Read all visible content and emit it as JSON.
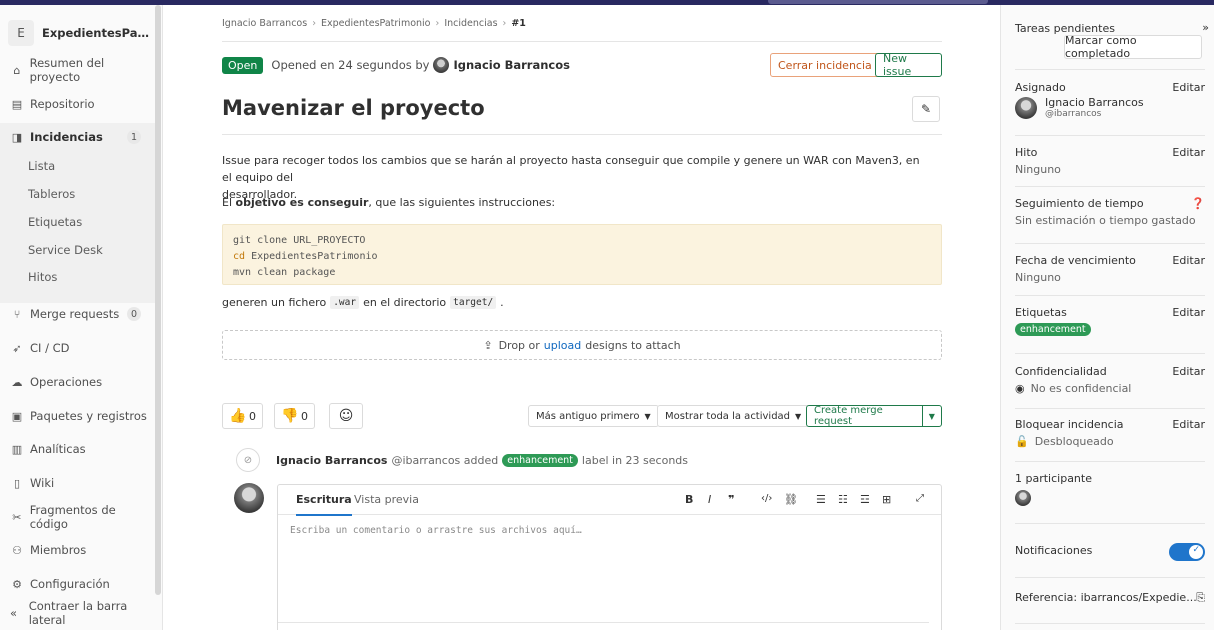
{
  "sidebar": {
    "project_initial": "E",
    "project_name": "ExpedientesPatrim...",
    "items": [
      {
        "label": "Resumen del proyecto",
        "icon": "home-icon"
      },
      {
        "label": "Repositorio",
        "icon": "file-icon"
      },
      {
        "label": "Incidencias",
        "icon": "issues-icon",
        "count": "1"
      },
      {
        "label": "Merge requests",
        "icon": "merge-request-icon",
        "count": "0"
      },
      {
        "label": "CI / CD",
        "icon": "rocket-icon"
      },
      {
        "label": "Operaciones",
        "icon": "cloud-icon"
      },
      {
        "label": "Paquetes y registros",
        "icon": "package-icon"
      },
      {
        "label": "Analíticas",
        "icon": "chart-icon"
      },
      {
        "label": "Wiki",
        "icon": "book-icon"
      },
      {
        "label": "Fragmentos de código",
        "icon": "snippet-icon"
      },
      {
        "label": "Miembros",
        "icon": "users-icon"
      },
      {
        "label": "Configuración",
        "icon": "gear-icon"
      }
    ],
    "sub_items": [
      "Lista",
      "Tableros",
      "Etiquetas",
      "Service Desk",
      "Hitos"
    ],
    "collapse_label": "Contraer la barra lateral"
  },
  "breadcrumb": [
    "Ignacio Barrancos",
    "ExpedientesPatrimonio",
    "Incidencias",
    "#1"
  ],
  "issue": {
    "status": "Open",
    "opened_prefix": "Opened en 24 segundos by",
    "author": "Ignacio Barrancos",
    "close_label": "Cerrar incidencia",
    "new_label": "New issue",
    "title": "Mavenizar el proyecto",
    "desc_line1": "Issue para recoger todos los cambios que se harán al proyecto hasta conseguir que compile y genere un WAR con Maven3, en el equipo del",
    "desc_line2": "desarrollador.",
    "desc2_prefix": "El",
    "desc2_bold": "objetivo es conseguir",
    "desc2_suffix": ", que las siguientes instrucciones:",
    "code": [
      "git clone URL_PROYECTO",
      "cd",
      "ExpedientesPatrimonio",
      "mvn clean package"
    ],
    "desc3_a": "generen un fichero",
    "desc3_code1": ".war",
    "desc3_b": "en el directorio",
    "desc3_code2": "target/",
    "desc3_c": ".",
    "drop_prefix": "Drop or",
    "drop_link": "upload",
    "drop_suffix": "designs to attach"
  },
  "reactions": {
    "thumbs_up": "0",
    "thumbs_down": "0"
  },
  "filters": {
    "sort": "Más antiguo primero",
    "activity": "Mostrar toda la actividad"
  },
  "create_mr_label": "Create merge request",
  "activity": {
    "user": "Ignacio Barrancos",
    "handle": "@ibarrancos",
    "added": "added",
    "label": "enhancement",
    "suffix": "label in 23 seconds"
  },
  "editor": {
    "tab_write": "Escritura",
    "tab_preview": "Vista previa",
    "placeholder": "Escriba un comentario o arrastre sus archivos aquí…"
  },
  "rightbar": {
    "todo_title": "Tareas pendientes",
    "todo_button": "Marcar como completado",
    "edit": "Editar",
    "assignee_title": "Asignado",
    "assignee_name": "Ignacio Barrancos",
    "assignee_handle": "@ibarrancos",
    "milestone_title": "Hito",
    "milestone_value": "Ninguno",
    "time_title": "Seguimiento de tiempo",
    "time_value": "Sin estimación o tiempo gastado",
    "due_title": "Fecha de vencimiento",
    "due_value": "Ninguno",
    "labels_title": "Etiquetas",
    "label_value": "enhancement",
    "conf_title": "Confidencialidad",
    "conf_value": "No es confidencial",
    "lock_title": "Bloquear incidencia",
    "lock_value": "Desbloqueado",
    "participants_title": "1 participante",
    "notif_title": "Notificaciones",
    "reference": "Referencia: ibarrancos/Expedie..."
  },
  "colors": {
    "open_badge": "#108548",
    "label": "#2e9a56",
    "accent": "#1f75cb",
    "close": "#c0561b"
  }
}
